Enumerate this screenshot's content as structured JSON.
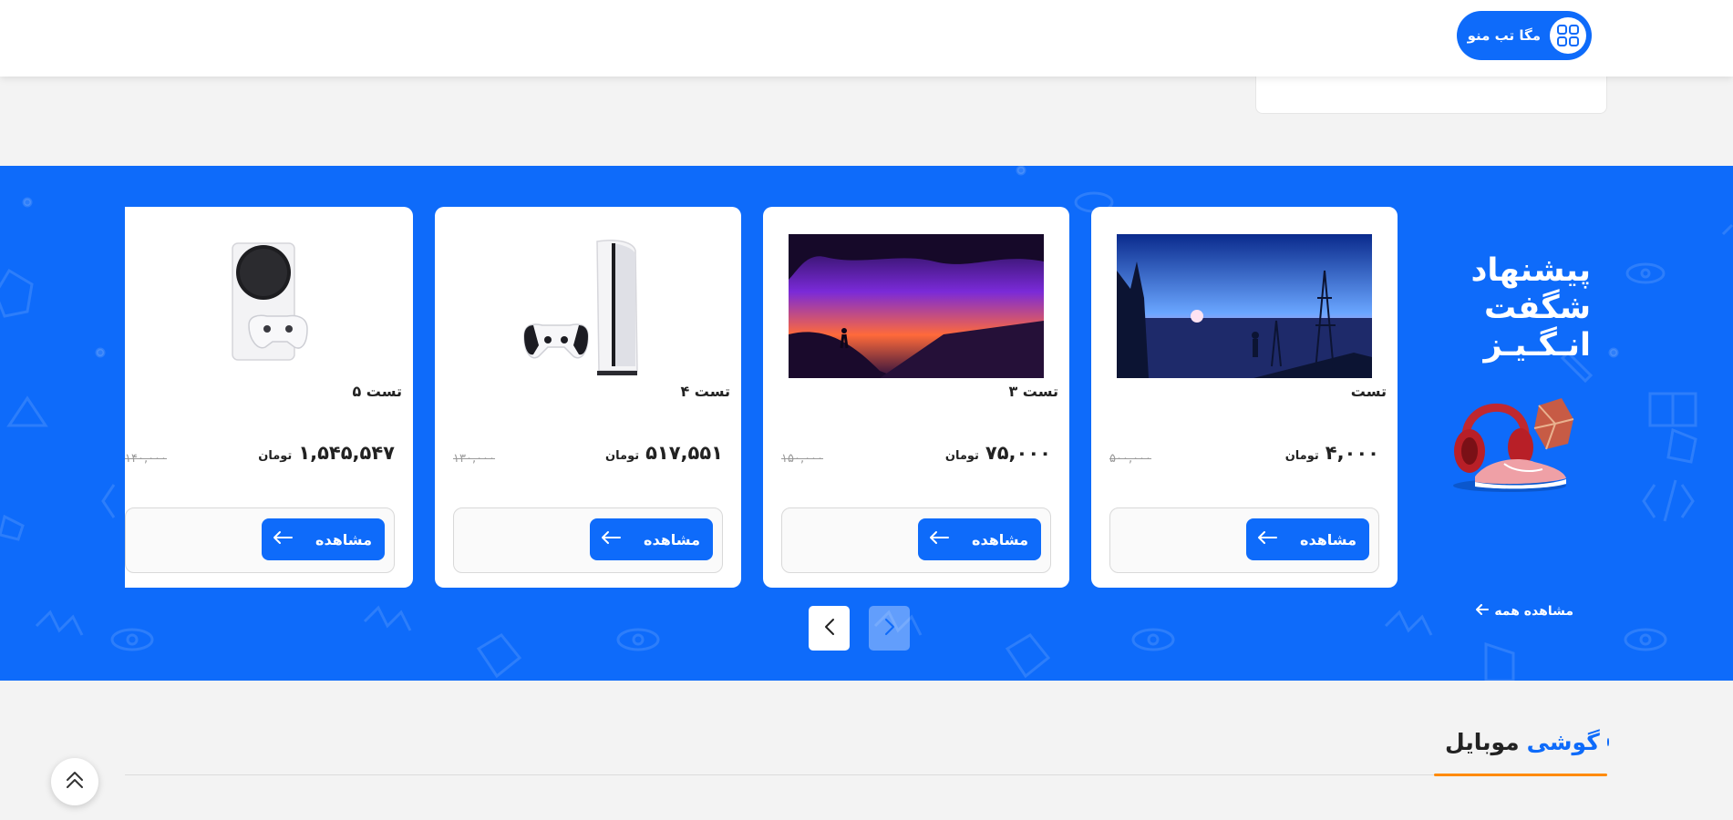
{
  "header": {
    "mega_menu_label": "مگا تب منو",
    "mega_menu_icon": "grid-apps-icon"
  },
  "amazing_offer": {
    "title_line1": "پیشنهاد",
    "title_line2": "شگفت",
    "title_line3": "انـگـیـز",
    "see_all_label": "مشاهده همه",
    "see_all_icon": "arrow-left-icon"
  },
  "products": [
    {
      "name": "تست",
      "price": "۴,۰۰۰",
      "currency": "تومان",
      "old_price": "۵۰۰,۰۰۰",
      "button_label": "مشاهده"
    },
    {
      "name": "تست ۳",
      "price": "۷۵,۰۰۰",
      "currency": "تومان",
      "old_price": "۱۵۰,۰۰۰",
      "button_label": "مشاهده"
    },
    {
      "name": "تست ۴",
      "price": "۵۱۷,۵۵۱",
      "currency": "تومان",
      "old_price": "۱۳۰,۰۰۰",
      "button_label": "مشاهده"
    },
    {
      "name": "تست ۵",
      "price": "۱,۵۴۵,۵۴۷",
      "currency": "تومان",
      "old_price": "۱۴۰,۰۰۰",
      "button_label": "مشاهده"
    }
  ],
  "slider": {
    "next_icon": "chevron-left-icon",
    "prev_icon": "chevron-right-icon"
  },
  "section": {
    "title_part1": "گوشی",
    "title_part2": "موبایل"
  },
  "scroll_top_icon": "double-chevron-up-icon",
  "colors": {
    "primary": "#0e6bfa",
    "accent_underline": "#ff8a00",
    "page_bg": "#f3f3f3"
  }
}
